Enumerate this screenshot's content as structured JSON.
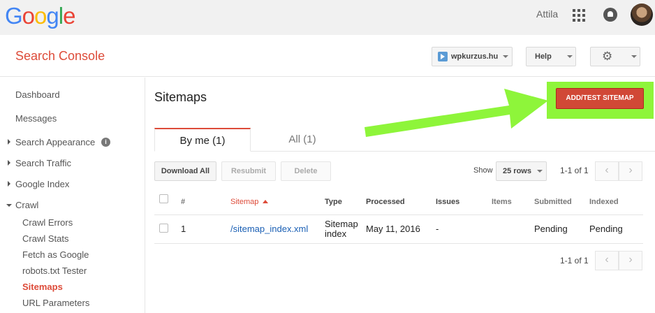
{
  "google": {
    "logo_letters": [
      {
        "ch": "G",
        "color": "#4285F4"
      },
      {
        "ch": "o",
        "color": "#EA4335"
      },
      {
        "ch": "o",
        "color": "#FBBC05"
      },
      {
        "ch": "g",
        "color": "#4285F4"
      },
      {
        "ch": "l",
        "color": "#34A853"
      },
      {
        "ch": "e",
        "color": "#EA4335"
      }
    ],
    "user": "Attila"
  },
  "header": {
    "title": "Search Console",
    "site": "wpkurzus.hu",
    "help": "Help"
  },
  "sidebar": {
    "dashboard": "Dashboard",
    "messages": "Messages",
    "search_appearance": "Search Appearance",
    "search_traffic": "Search Traffic",
    "google_index": "Google Index",
    "crawl": "Crawl",
    "crawl_items": [
      "Crawl Errors",
      "Crawl Stats",
      "Fetch as Google",
      "robots.txt Tester",
      "Sitemaps",
      "URL Parameters"
    ]
  },
  "main": {
    "title": "Sitemaps",
    "add_button": "ADD/TEST SITEMAP",
    "tabs": [
      "By me (1)",
      "All (1)"
    ],
    "actions": {
      "download": "Download All",
      "resubmit": "Resubmit",
      "delete": "Delete"
    },
    "show_label": "Show",
    "rows_value": "25 rows",
    "pager": "1-1 of 1"
  },
  "table": {
    "headers": {
      "num": "#",
      "sitemap": "Sitemap",
      "type": "Type",
      "processed": "Processed",
      "issues": "Issues",
      "items": "Items",
      "submitted": "Submitted",
      "indexed": "Indexed"
    },
    "rows": [
      {
        "num": "1",
        "sitemap": "/sitemap_index.xml",
        "type_line1": "Sitemap",
        "type_line2": "index",
        "processed": "May 11, 2016",
        "issues": "-",
        "items": "",
        "submitted": "Pending",
        "indexed": "Pending"
      }
    ]
  },
  "colors": {
    "brand_red": "#dd4b39",
    "highlight_green": "#8ef53a",
    "link_blue": "#1a5fb4"
  }
}
